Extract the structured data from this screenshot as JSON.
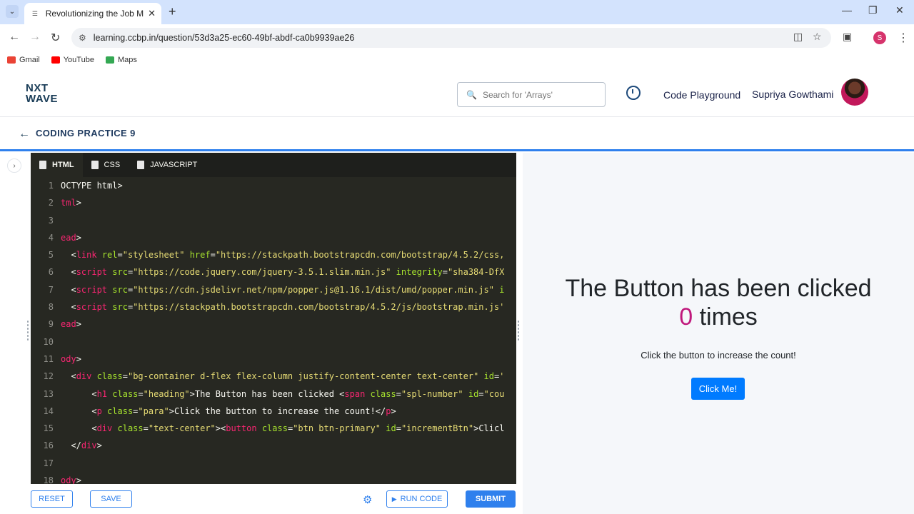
{
  "browser": {
    "tab_title": "Revolutionizing the Job Market",
    "url": "learning.ccbp.in/question/53d3a25-ec60-49bf-abdf-ca0b9939ae26",
    "profile_initial": "S",
    "bookmarks": [
      {
        "label": "Gmail",
        "color": "#ea4335"
      },
      {
        "label": "YouTube",
        "color": "#ff0000"
      },
      {
        "label": "Maps",
        "color": "#34a853"
      }
    ]
  },
  "header": {
    "logo_line1": "NXT",
    "logo_line2": "WAVE",
    "search_placeholder": "Search for 'Arrays'",
    "code_playground": "Code Playground",
    "username": "Supriya Gowthami"
  },
  "subheader": {
    "title": "CODING PRACTICE 9"
  },
  "editor": {
    "tabs": [
      "HTML",
      "CSS",
      "JAVASCRIPT"
    ],
    "line_numbers": [
      "1",
      "2",
      "3",
      "4",
      "5",
      "6",
      "7",
      "8",
      "9",
      "10",
      "11",
      "12",
      "13",
      "14",
      "15",
      "16",
      "17",
      "18"
    ]
  },
  "preview": {
    "heading_text": "The Button has been clicked",
    "count": "0",
    "times": "times",
    "para": "Click the button to increase the count!",
    "button": "Click Me!"
  },
  "actions": {
    "reset": "RESET",
    "save": "SAVE",
    "run_code": "RUN CODE",
    "submit": "SUBMIT"
  }
}
